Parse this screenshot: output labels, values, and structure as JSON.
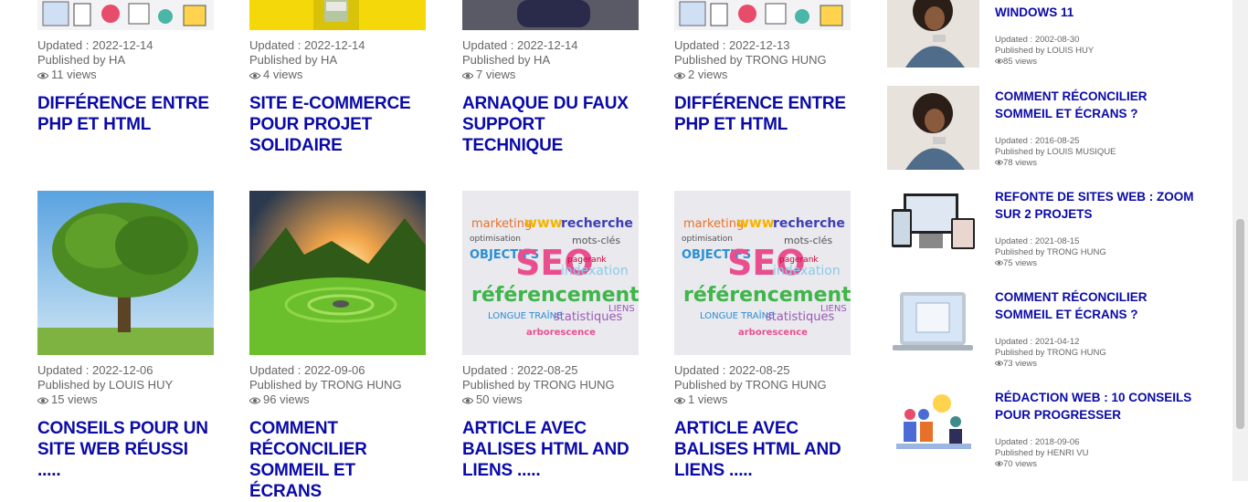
{
  "posts": [
    {
      "updated": "Updated : 2022-12-14",
      "author": "Published by HA",
      "views": "11 views",
      "title": "DIFFÉRENCE ENTRE PHP ET HTML",
      "thumb": "doodle"
    },
    {
      "updated": "Updated : 2022-12-14",
      "author": "Published by HA",
      "views": "4 views",
      "title": "SITE E-COMMERCE POUR PROJET SOLIDAIRE",
      "thumb": "yellow"
    },
    {
      "updated": "Updated : 2022-12-14",
      "author": "Published by HA",
      "views": "7 views",
      "title": "ARNAQUE DU FAUX SUPPORT TECHNIQUE",
      "thumb": "dark"
    },
    {
      "updated": "Updated : 2022-12-13",
      "author": "Published by TRONG HUNG",
      "views": "2 views",
      "title": "DIFFÉRENCE ENTRE PHP ET HTML",
      "thumb": "doodle"
    },
    {
      "updated": "Updated : 2022-12-06",
      "author": "Published by LOUIS HUY",
      "views": "15 views",
      "title": "CONSEILS POUR UN SITE WEB RÉUSSI .....",
      "thumb": "tree"
    },
    {
      "updated": "Updated : 2022-09-06",
      "author": "Published by TRONG HUNG",
      "views": "96 views",
      "title": "COMMENT RÉCONCILIER SOMMEIL ET ÉCRANS",
      "thumb": "landscape"
    },
    {
      "updated": "Updated : 2022-08-25",
      "author": "Published by TRONG HUNG",
      "views": "50 views",
      "title": "ARTICLE AVEC BALISES HTML AND LIENS .....",
      "thumb": "seo"
    },
    {
      "updated": "Updated : 2022-08-25",
      "author": "Published by TRONG HUNG",
      "views": "1 views",
      "title": "ARTICLE AVEC BALISES HTML AND LIENS .....",
      "thumb": "seo"
    }
  ],
  "sidebar": [
    {
      "title": "WINDOWS 11",
      "updated": "Updated : 2002-08-30",
      "author": "Published by LOUIS HUY",
      "views": "85 views",
      "thumb": "woman"
    },
    {
      "title": "COMMENT RÉCONCILIER SOMMEIL ET ÉCRANS ?",
      "updated": "Updated : 2016-08-25",
      "author": "Published by LOUIS MUSIQUE",
      "views": "78 views",
      "thumb": "woman"
    },
    {
      "title": "REFONTE DE SITES WEB : ZOOM SUR 2 PROJETS",
      "updated": "Updated : 2021-08-15",
      "author": "Published by TRONG HUNG",
      "views": "75 views",
      "thumb": "devices"
    },
    {
      "title": "COMMENT RÉCONCILIER SOMMEIL ET ÉCRANS ?",
      "updated": "Updated : 2021-04-12",
      "author": "Published by TRONG HUNG",
      "views": "73 views",
      "thumb": "laptop"
    },
    {
      "title": "RÉDACTION WEB : 10 CONSEILS POUR PROGRESSER",
      "updated": "Updated : 2018-09-06",
      "author": "Published by HENRI VU",
      "views": "70 views",
      "thumb": "team"
    }
  ],
  "seo_words": {
    "marketing": "marketing",
    "www": "www",
    "recherche": "recherche",
    "optimisation": "optimisation",
    "objectifs": "OBJECTIFS",
    "seo": "SEO",
    "indexation": "indexation",
    "referencement": "référencement",
    "longue": "LONGUE TRAÎNE",
    "statistiques": "statistiques",
    "arborescence": "arborescence",
    "liens": "LIENS",
    "pagerank": "pagerank",
    "motscles": "mots-clés"
  }
}
